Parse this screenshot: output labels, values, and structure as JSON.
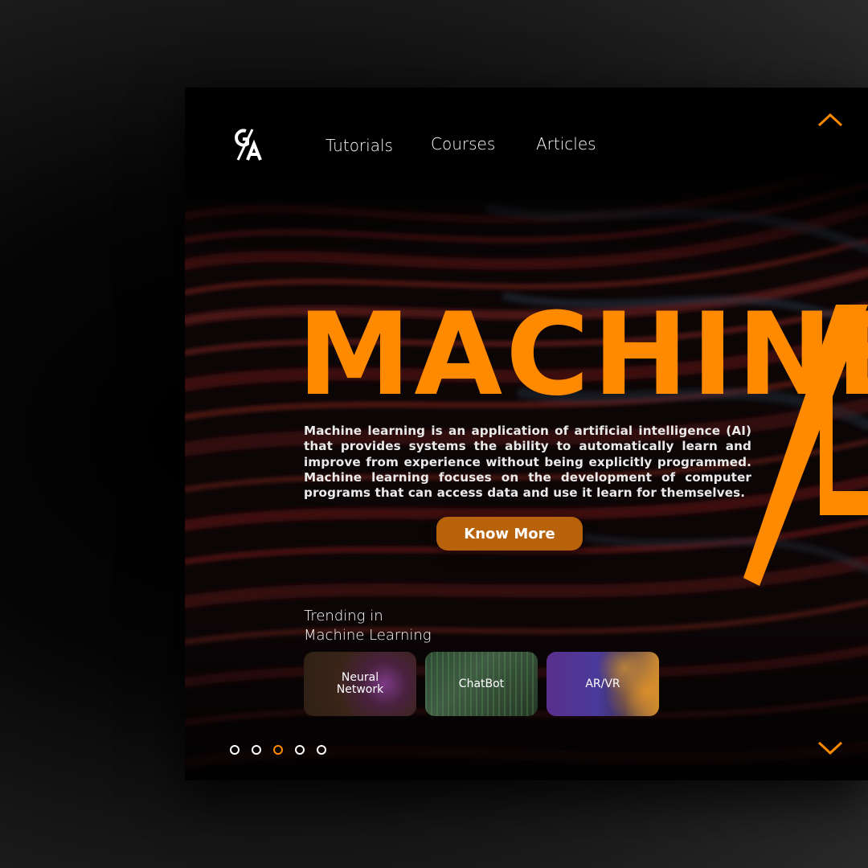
{
  "nav": {
    "items": [
      "Tutorials",
      "Courses",
      "Articles"
    ]
  },
  "hero": {
    "title": "MACHINE",
    "description": "Machine learning is an application of artificial intelligence (AI) that provides systems the ability to automatically learn and improve from experience without being explicitly programmed. Machine learning focuses on the development of computer programs that can access data and use it learn for themselves.",
    "cta_label": "Know More"
  },
  "trending": {
    "heading_line1": "Trending in",
    "heading_line2": "Machine Learning",
    "cards": [
      "Neural\nNetwork",
      "ChatBot",
      "AR/VR"
    ]
  },
  "pagination": {
    "total": 5,
    "active_index": 2
  },
  "icons": {
    "logo": "ga-logo-icon",
    "scroll_up": "chevron-up-icon",
    "scroll_down": "chevron-down-icon"
  },
  "colors": {
    "accent": "#ff8a00",
    "button": "#b9620c",
    "background": "#0b0506",
    "text": "#ffffff"
  }
}
